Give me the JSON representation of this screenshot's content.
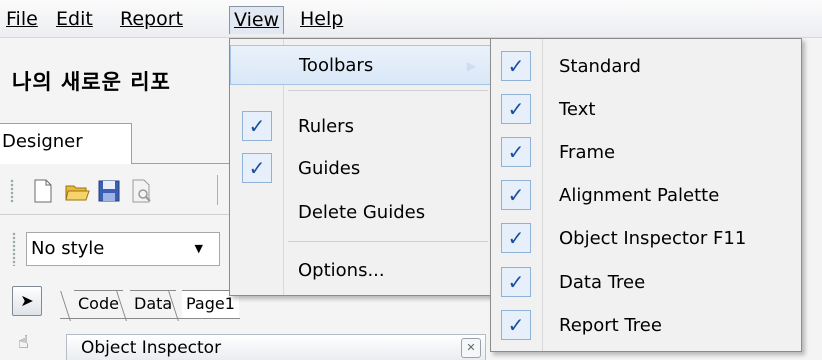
{
  "menubar": {
    "file": "File",
    "edit": "Edit",
    "report": "Report",
    "view": "View",
    "help": "Help"
  },
  "report_title": "나의 새로운 리포",
  "designer_tab": "Designer",
  "style_combo": "No style",
  "page_tabs": [
    "Code",
    "Data",
    "Page1"
  ],
  "object_inspector": "Object Inspector",
  "view_menu": {
    "toolbars": "Toolbars",
    "rulers": "Rulers",
    "rulers_checked": true,
    "guides": "Guides",
    "guides_checked": true,
    "delete_guides": "Delete Guides",
    "options": "Options..."
  },
  "toolbars_menu": [
    {
      "label": "Standard",
      "checked": true
    },
    {
      "label": "Text",
      "checked": true
    },
    {
      "label": "Frame",
      "checked": true
    },
    {
      "label": "Alignment Palette",
      "checked": true
    },
    {
      "label": "Object Inspector F11",
      "checked": true
    },
    {
      "label": "Data Tree",
      "checked": true
    },
    {
      "label": "Report Tree",
      "checked": true
    }
  ],
  "icons": {
    "check": "checkmark-icon",
    "submenu": "chevron-right-icon"
  },
  "colors": {
    "check_fg": "#1b4f9c",
    "check_bg": "#e6effa",
    "highlight": "#d9e7f7"
  }
}
